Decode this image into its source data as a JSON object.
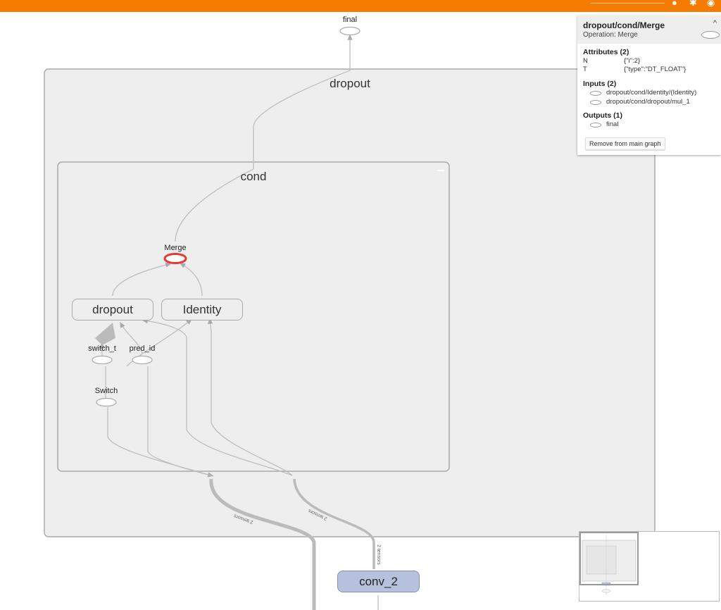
{
  "graph": {
    "final_label": "final",
    "dropout_outer_title": "dropout",
    "cond_title": "cond",
    "merge_label": "Merge",
    "dropout_inner_label": "dropout",
    "identity_label": "Identity",
    "switch_t_label": "switch_t",
    "pred_id_label": "pred_id",
    "switch_label": "Switch",
    "conv2_label": "conv_2",
    "edge_label_left": "2 tensors",
    "edge_label_right": "2 tensors",
    "edge_label_conv": "2 tensors"
  },
  "info_card": {
    "title": "dropout/cond/Merge",
    "operation": "Operation: Merge",
    "attributes_title": "Attributes (2)",
    "attributes": [
      {
        "key": "N",
        "value": "{\"i\":2}"
      },
      {
        "key": "T",
        "value": "{\"type\":\"DT_FLOAT\"}"
      }
    ],
    "inputs_title": "Inputs (2)",
    "inputs": [
      "dropout/cond/Identity/(Identity)",
      "dropout/cond/dropout/mul_1"
    ],
    "outputs_title": "Outputs (1)",
    "outputs": [
      "final"
    ],
    "remove_button": "Remove from main graph"
  },
  "colors": {
    "header": "#f57c00",
    "selected_node": "#e53935",
    "group_fill": "#eeeeee",
    "conv_fill": "#b6c2dd"
  },
  "icons": [
    "search-icon",
    "settings-icon",
    "help-icon",
    "collapse-caret-icon"
  ]
}
